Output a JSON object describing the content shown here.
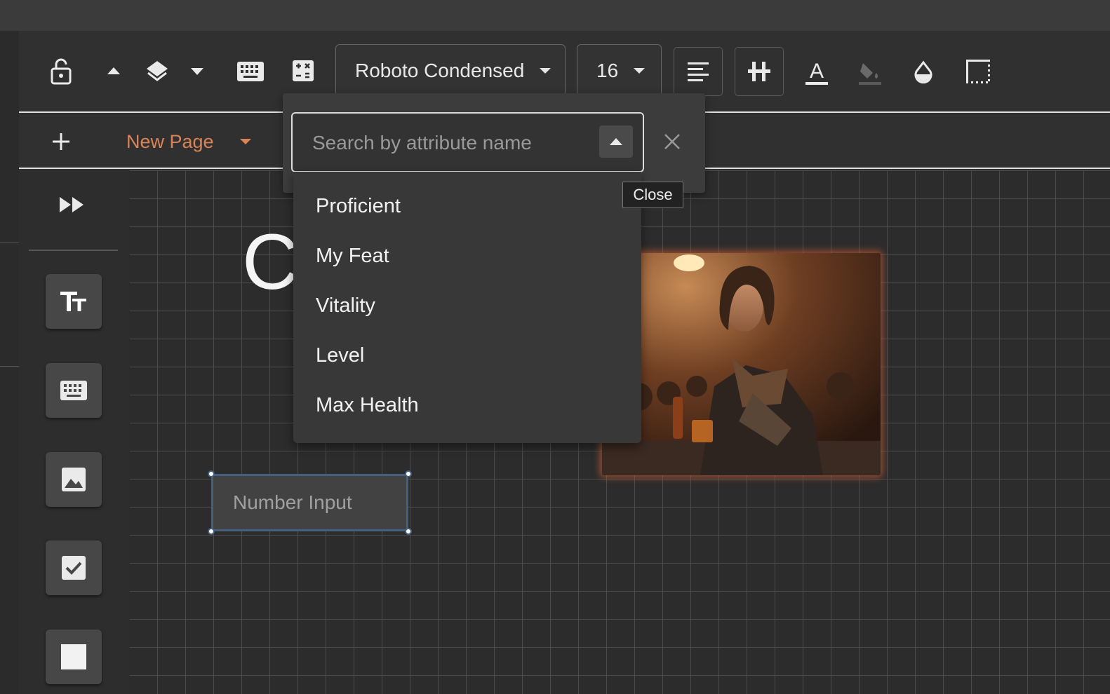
{
  "toolbar": {
    "icons": [
      "lock-open-icon",
      "chevron-up-icon",
      "layers-icon",
      "chevron-down-icon",
      "keyboard-icon",
      "calculator-icon",
      "align-left-icon",
      "grid-plus-icon",
      "font-color-icon",
      "fill-color-icon",
      "opacity-drop-icon",
      "border-style-icon"
    ],
    "font_family": "Roboto Condensed",
    "font_size": "16"
  },
  "pagebar": {
    "page_name": "New Page"
  },
  "attribute_search": {
    "placeholder": "Search by attribute name",
    "close_tooltip": "Close",
    "options": [
      "Proficient",
      "My Feat",
      "Vitality",
      "Level",
      "Max Health"
    ]
  },
  "canvas": {
    "heading_fragment": "C",
    "number_input_label": "Number Input"
  },
  "colors": {
    "accent": "#d98356",
    "selection": "#44607e",
    "image_glow": "#d66036"
  }
}
